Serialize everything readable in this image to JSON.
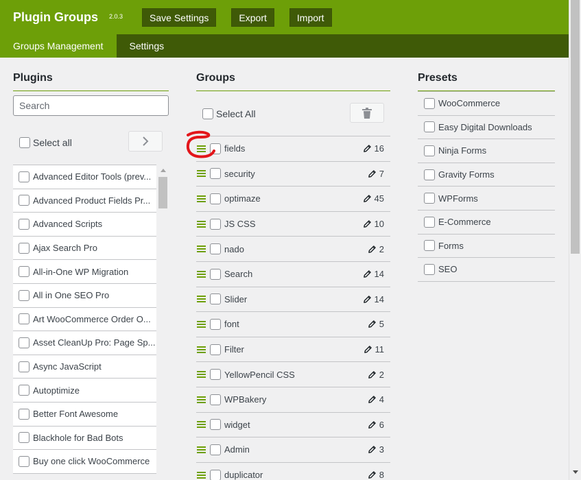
{
  "header": {
    "title": "Plugin Groups",
    "version": "2.0.3",
    "buttons": {
      "save": "Save Settings",
      "export": "Export",
      "import": "Import"
    }
  },
  "tabs": [
    {
      "label": "Groups Management",
      "active": true
    },
    {
      "label": "Settings",
      "active": false
    }
  ],
  "plugins": {
    "heading": "Plugins",
    "search_placeholder": "Search",
    "select_all_label": "Select all",
    "items": [
      "Advanced Editor Tools (prev...",
      "Advanced Product Fields Pr...",
      "Advanced Scripts",
      "Ajax Search Pro",
      "All-in-One WP Migration",
      "All in One SEO Pro",
      "Art WooCommerce Order O...",
      "Asset CleanUp Pro: Page Sp...",
      "Async JavaScript",
      "Autoptimize",
      "Better Font Awesome",
      "Blackhole for Bad Bots",
      "Buy one click WooCommerce"
    ]
  },
  "groups": {
    "heading": "Groups",
    "select_all_label": "Select All",
    "items": [
      {
        "name": "fields",
        "count": "16"
      },
      {
        "name": "security",
        "count": "7"
      },
      {
        "name": "optimaze",
        "count": "45"
      },
      {
        "name": "JS CSS",
        "count": "10"
      },
      {
        "name": "nado",
        "count": "2"
      },
      {
        "name": "Search",
        "count": "14"
      },
      {
        "name": "Slider",
        "count": "14"
      },
      {
        "name": "font",
        "count": "5"
      },
      {
        "name": "Filter",
        "count": "11"
      },
      {
        "name": "YellowPencil CSS",
        "count": "2"
      },
      {
        "name": "WPBakery",
        "count": "4"
      },
      {
        "name": "widget",
        "count": "6"
      },
      {
        "name": "Admin",
        "count": "3"
      },
      {
        "name": "duplicator",
        "count": "8"
      }
    ]
  },
  "presets": {
    "heading": "Presets",
    "items": [
      "WooCommerce",
      "Easy Digital Downloads",
      "Ninja Forms",
      "Gravity Forms",
      "WPForms",
      "E-Commerce",
      "Forms",
      "SEO"
    ]
  },
  "colors": {
    "brand_green": "#6d9f08",
    "dark_green": "#3f5a07",
    "annotation_red": "#e3161b"
  }
}
